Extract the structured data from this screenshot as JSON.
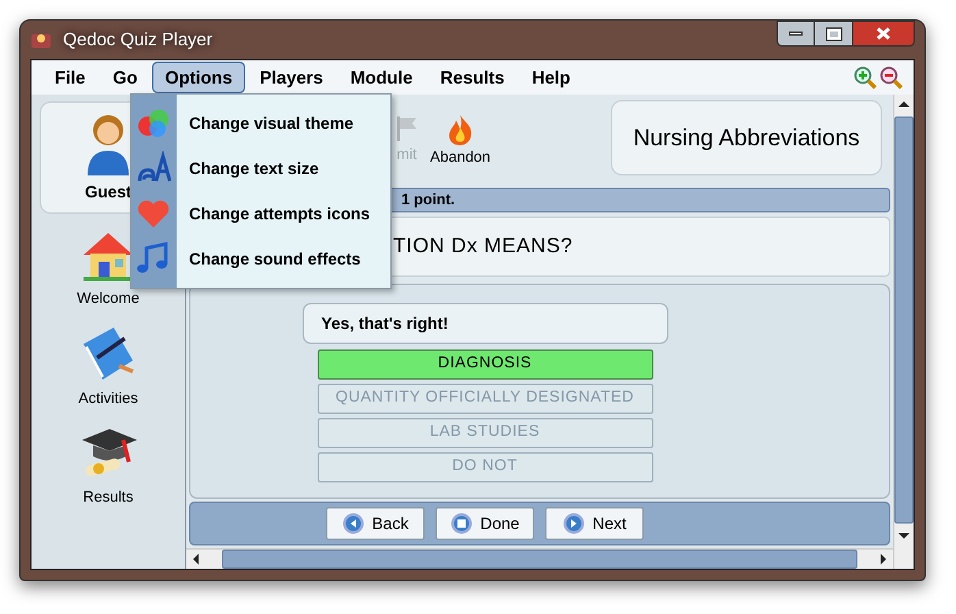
{
  "window": {
    "title": "Qedoc Quiz Player"
  },
  "menu": [
    {
      "label": "File",
      "selected": false
    },
    {
      "label": "Go",
      "selected": false
    },
    {
      "label": "Options",
      "selected": true
    },
    {
      "label": "Players",
      "selected": false
    },
    {
      "label": "Module",
      "selected": false
    },
    {
      "label": "Results",
      "selected": false
    },
    {
      "label": "Help",
      "selected": false
    }
  ],
  "options_menu": [
    {
      "label": "Change visual theme",
      "kind": "theme"
    },
    {
      "label": "Change text size",
      "kind": "text"
    },
    {
      "label": "Change attempts icons",
      "kind": "heart"
    },
    {
      "label": "Change sound effects",
      "kind": "music"
    }
  ],
  "user": {
    "name": "Guest"
  },
  "sidebar": [
    {
      "label": "Welcome",
      "kind": "home"
    },
    {
      "label": "Activities",
      "kind": "book"
    },
    {
      "label": "Results",
      "kind": "cap"
    }
  ],
  "toolbar": [
    {
      "label": "mit",
      "disabled": true,
      "kind": "flag"
    },
    {
      "label": "Abandon",
      "disabled": false,
      "kind": "fire"
    }
  ],
  "module_title": "Nursing Abbreviations",
  "status": "1 point.",
  "question": "TION Dx MEANS?",
  "feedback": "Yes, that's right!",
  "answers": [
    {
      "label": "DIAGNOSIS",
      "selected": true
    },
    {
      "label": "QUANTITY OFFICIALLY DESIGNATED",
      "selected": false
    },
    {
      "label": "LAB STUDIES",
      "selected": false
    },
    {
      "label": "DO NOT",
      "selected": false
    }
  ],
  "nav": [
    {
      "label": "Back",
      "kind": "back"
    },
    {
      "label": "Done",
      "kind": "done"
    },
    {
      "label": "Next",
      "kind": "next"
    }
  ]
}
